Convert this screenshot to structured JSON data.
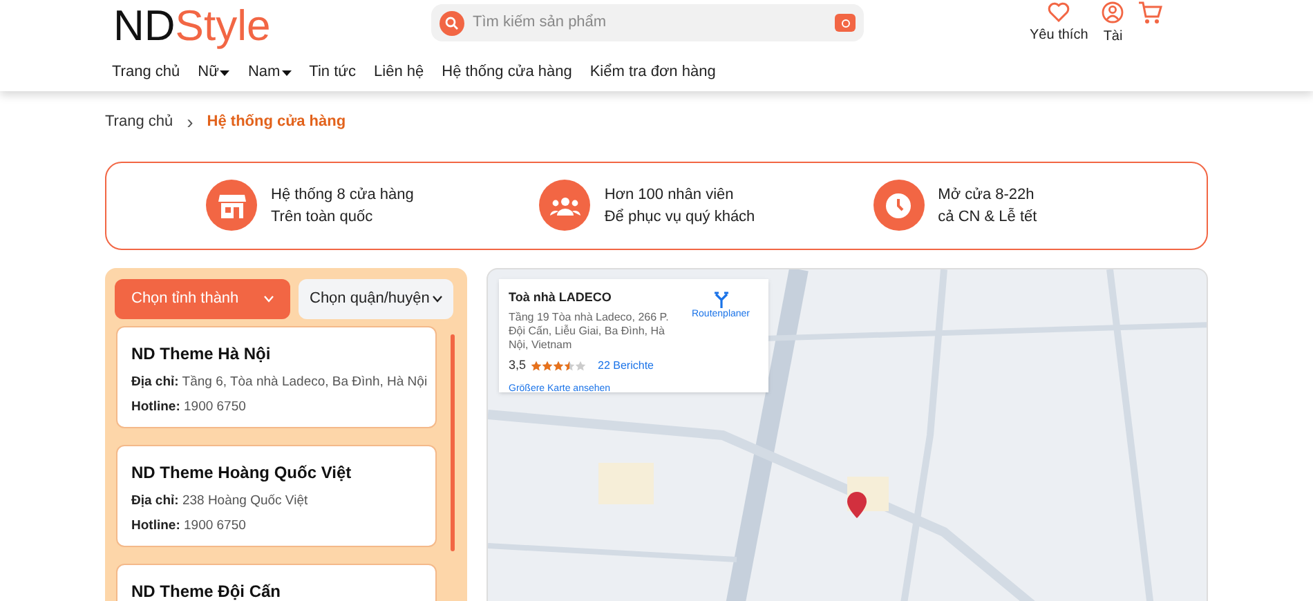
{
  "header": {
    "logo": {
      "dark": "ND",
      "accent": "Style"
    },
    "search": {
      "placeholder": "Tìm kiếm sản phẩm"
    },
    "actions": [
      {
        "kind": "heart",
        "label": "Yêu thích"
      },
      {
        "kind": "user",
        "label": "Tài"
      },
      {
        "kind": "cart"
      }
    ]
  },
  "nav": [
    {
      "label": "Trang chủ",
      "dropdown": false
    },
    {
      "label": "Nữ",
      "dropdown": true
    },
    {
      "label": "Nam",
      "dropdown": true
    },
    {
      "label": "Tin tức",
      "dropdown": false
    },
    {
      "label": "Liên hệ",
      "dropdown": false
    },
    {
      "label": "Hệ thống cửa hàng",
      "dropdown": false
    },
    {
      "label": "Kiểm tra đơn hàng",
      "dropdown": false
    }
  ],
  "breadcrumb": {
    "separator": "›",
    "items": [
      {
        "label": "Trang chủ",
        "current": false
      },
      {
        "label": "Hệ thống cửa hàng",
        "current": true
      }
    ]
  },
  "features": [
    {
      "kind": "store",
      "title": "Hệ thống 8 cửa hàng",
      "subtitle": "Trên toàn quốc"
    },
    {
      "kind": "people",
      "title": "Hơn 100 nhân viên",
      "subtitle": "Để phục vụ quý khách"
    },
    {
      "kind": "clock",
      "title": "Mở cửa 8-22h",
      "subtitle": "cả CN & Lễ tết"
    }
  ],
  "filters": [
    {
      "label": "Chọn tỉnh thành",
      "active": true
    },
    {
      "label": "Chọn quận/huyện",
      "active": false
    }
  ],
  "stores": [
    {
      "name": "ND Theme Hà Nội",
      "address_label": "Địa chỉ:",
      "address": "Tầng 6, Tòa nhà Ladeco, Ba Đình, Hà Nội",
      "hotline_label": "Hotline:",
      "hotline": "1900 6750"
    },
    {
      "name": "ND Theme Hoàng Quốc Việt",
      "address_label": "Địa chỉ:",
      "address": "238 Hoàng Quốc Việt",
      "hotline_label": "Hotline:",
      "hotline": "1900 6750"
    },
    {
      "name": "ND Theme Đội Cấn"
    }
  ],
  "map_card": {
    "title": "Toà nhà LADECO",
    "address": "Tầng 19 Tòa nhà Ladeco, 266 P. Đội Cấn, Liễu Giai, Ba Đình, Hà Nội, Vietnam",
    "rating": "3,5",
    "stars": 3.5,
    "reviews": "22 Berichte",
    "directions": "Routenplaner",
    "larger_map": "Größere Karte ansehen"
  }
}
